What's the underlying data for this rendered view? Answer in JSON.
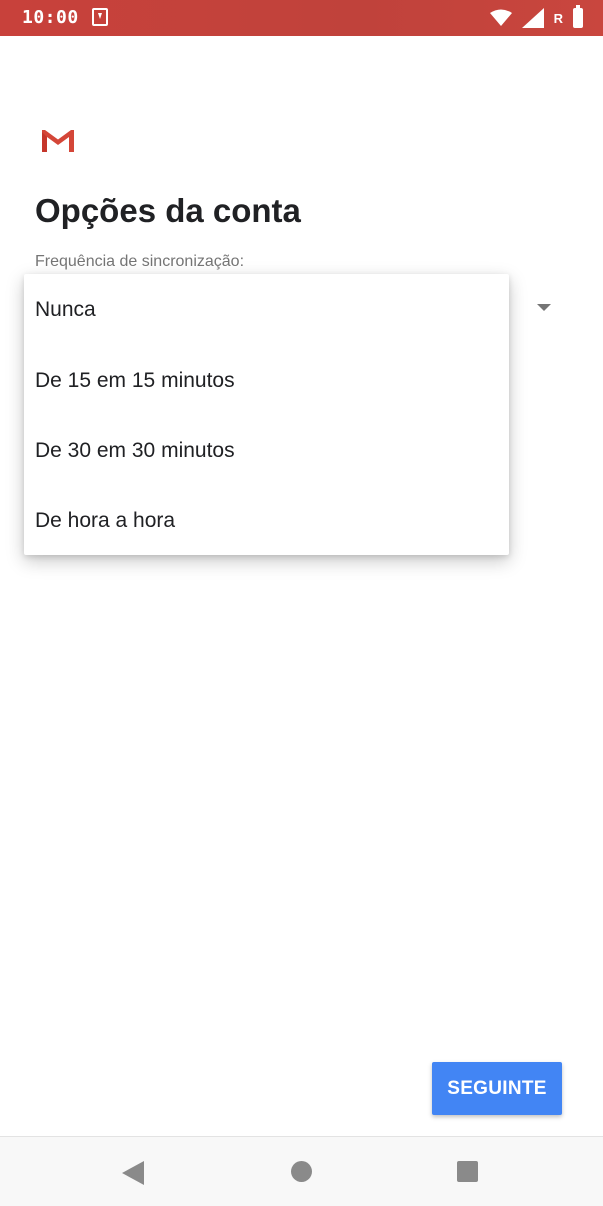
{
  "status_bar": {
    "time": "10:00",
    "roaming_indicator": "R",
    "icons": [
      "download-icon",
      "wifi-icon",
      "signal-icon",
      "battery-icon"
    ],
    "background_color": "#c5423c"
  },
  "header": {
    "logo": "gmail-logo",
    "title": "Opções da conta"
  },
  "sync": {
    "label": "Frequência de sincronização:",
    "options": [
      "Nunca",
      "De 15 em 15 minutos",
      "De 30 em 30 minutos",
      "De hora a hora"
    ]
  },
  "footer": {
    "next_label": "SEGUINTE",
    "accent_color": "#4285f4"
  },
  "nav": {
    "icons": [
      "back-icon",
      "home-icon",
      "recents-icon"
    ]
  }
}
